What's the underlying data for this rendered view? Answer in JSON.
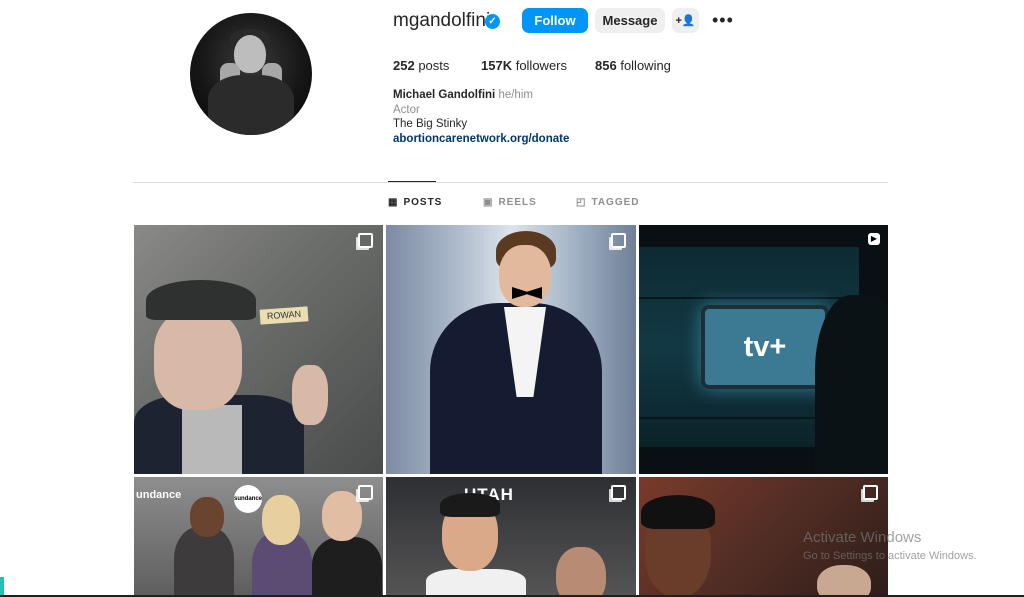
{
  "profile": {
    "username": "mgandolfini",
    "verified_symbol": "✓",
    "buttons": {
      "follow": "Follow",
      "message": "Message",
      "add_user_symbol": "+👤",
      "more_symbol": "•••"
    },
    "stats": {
      "posts_count": "252",
      "posts_label": "posts",
      "followers_count": "157K",
      "followers_label": "followers",
      "following_count": "856",
      "following_label": "following"
    },
    "bio": {
      "name": "Michael Gandolfini",
      "pronouns": "he/him",
      "category": "Actor",
      "text": "The Big Stinky",
      "link": "abortioncarenetwork.org/donate"
    }
  },
  "tabs": [
    {
      "label": "POSTS",
      "icon": "grid-icon",
      "symbol": "▦",
      "active": true
    },
    {
      "label": "REELS",
      "icon": "reels-icon",
      "symbol": "▣",
      "active": false
    },
    {
      "label": "TAGGED",
      "icon": "tagged-icon",
      "symbol": "◰",
      "active": false
    }
  ],
  "grid": {
    "tiles": [
      {
        "kind": "carousel",
        "sticker_text": "ROWAN"
      },
      {
        "kind": "carousel"
      },
      {
        "kind": "reel",
        "overlay_text": "tv+"
      },
      {
        "kind": "carousel",
        "banner_text": "undance",
        "logo_text": "sundance"
      },
      {
        "kind": "carousel",
        "sign_text": "UTAH"
      },
      {
        "kind": "carousel"
      }
    ]
  },
  "os": {
    "watermark_title": "Activate Windows",
    "watermark_subtitle": "Go to Settings to activate Windows."
  },
  "colors": {
    "accent": "#0095f6",
    "link": "#00376b",
    "muted": "#8e8e8e"
  }
}
